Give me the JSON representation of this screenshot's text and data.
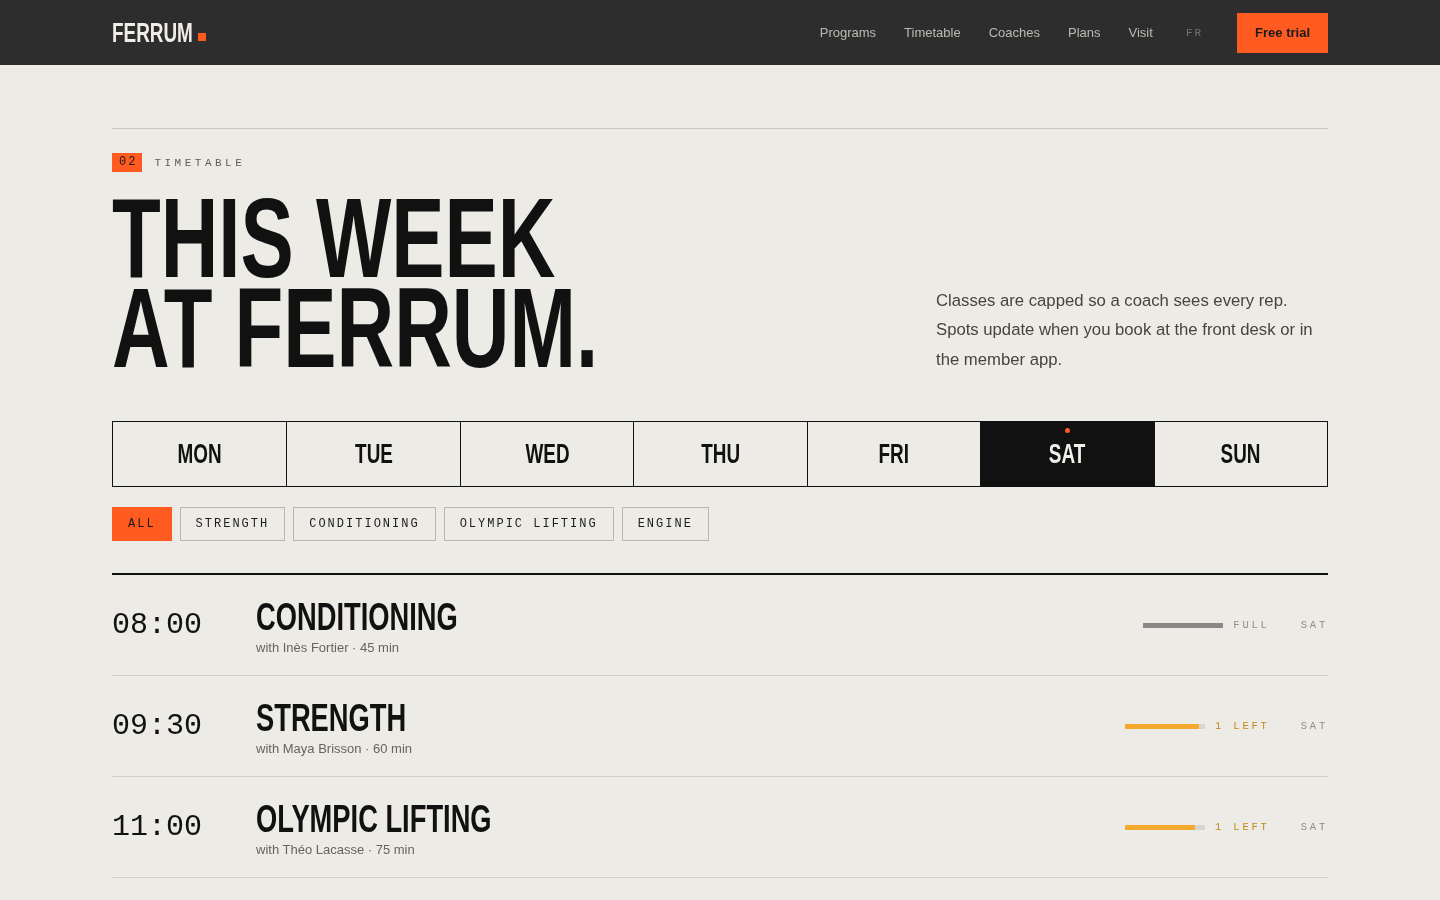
{
  "nav": {
    "logo": "FERRUM",
    "links": [
      "Programs",
      "Timetable",
      "Coaches",
      "Plans",
      "Visit"
    ],
    "language": "FR",
    "cta": "Free trial"
  },
  "section": {
    "number": "02",
    "label": "TIMETABLE",
    "title_lines": [
      "THIS WEEK",
      "AT FERRUM."
    ],
    "intro": "Classes are capped so a coach sees every rep. Spots update when you book at the front desk or in the member app."
  },
  "days": [
    {
      "label": "MON",
      "selected": false,
      "today": false
    },
    {
      "label": "TUE",
      "selected": false,
      "today": false
    },
    {
      "label": "WED",
      "selected": false,
      "today": false
    },
    {
      "label": "THU",
      "selected": false,
      "today": false
    },
    {
      "label": "FRI",
      "selected": false,
      "today": false
    },
    {
      "label": "SAT",
      "selected": true,
      "today": true
    },
    {
      "label": "SUN",
      "selected": false,
      "today": false
    }
  ],
  "filters": [
    {
      "label": "ALL",
      "selected": true
    },
    {
      "label": "STRENGTH",
      "selected": false
    },
    {
      "label": "CONDITIONING",
      "selected": false
    },
    {
      "label": "OLYMPIC LIFTING",
      "selected": false
    },
    {
      "label": "ENGINE",
      "selected": false
    }
  ],
  "classes": [
    {
      "time": "08:00",
      "name": "CONDITIONING",
      "details": "with Inès Fortier · 45 min",
      "kind": "full",
      "level": 1,
      "availability": "FULL",
      "day": "SAT"
    },
    {
      "time": "09:30",
      "name": "STRENGTH",
      "details": "with Maya Brisson · 60 min",
      "kind": "open",
      "level": 0.92,
      "availability": "1 LEFT",
      "day": "SAT"
    },
    {
      "time": "11:00",
      "name": "OLYMPIC LIFTING",
      "details": "with Théo Lacasse · 75 min",
      "kind": "open",
      "level": 0.87,
      "availability": "1 LEFT",
      "day": "SAT"
    }
  ]
}
